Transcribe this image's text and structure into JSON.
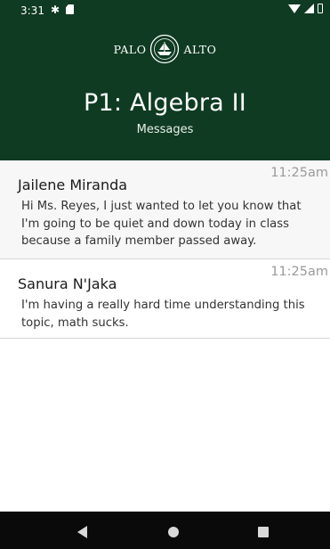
{
  "status_bar": {
    "time": "3:31"
  },
  "header": {
    "logo_left": "PALO",
    "logo_right": "ALTO",
    "title": "P1: Algebra II",
    "subtitle": "Messages"
  },
  "messages": [
    {
      "sender": "Jailene Miranda",
      "time": "11:25am",
      "text": "Hi Ms. Reyes, I just wanted to let you know that I'm going to be quiet and down today in class because a family member passed away."
    },
    {
      "sender": "Sanura N'Jaka",
      "time": "11:25am",
      "text": "I'm having a really hard time understanding this topic, math sucks."
    }
  ],
  "colors": {
    "header_bg": "#0f3b22",
    "navbar_bg": "#0a0a0a"
  }
}
